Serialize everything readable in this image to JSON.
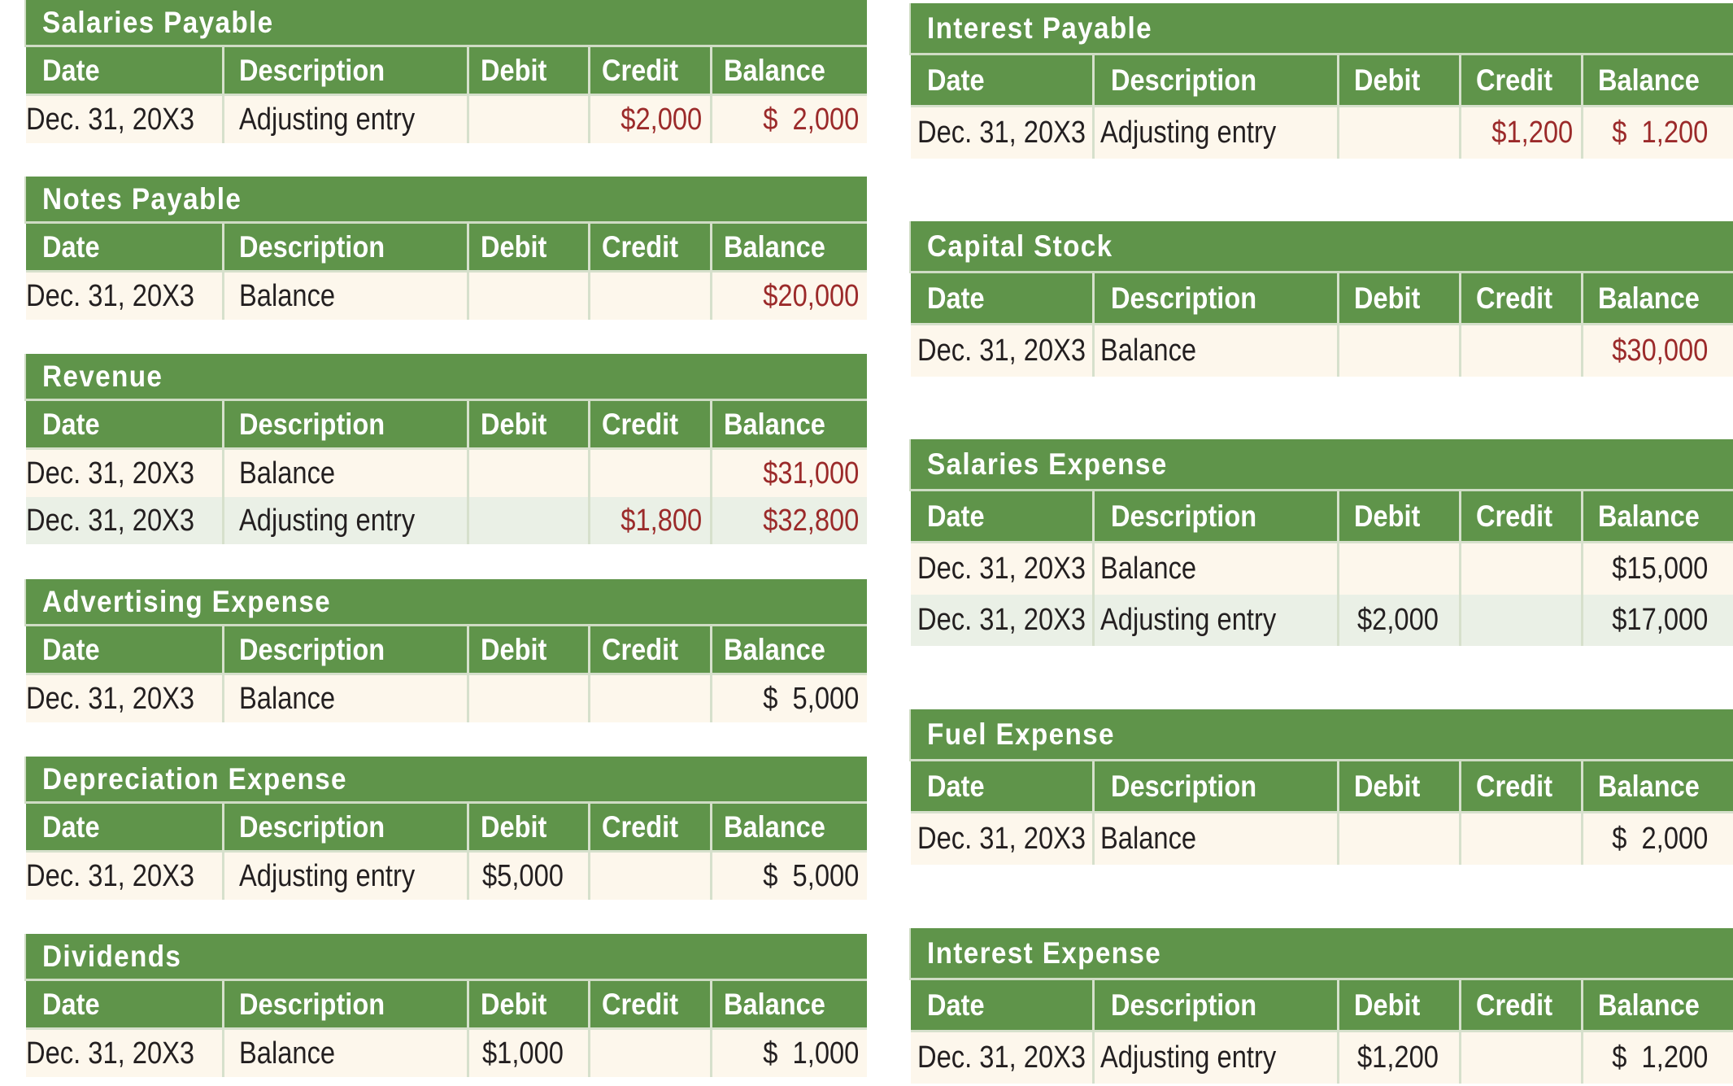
{
  "columns": [
    "Date",
    "Description",
    "Debit",
    "Credit",
    "Balance"
  ],
  "colors": {
    "header_green": "#5f944a",
    "row_cream": "#fdf7ec",
    "row_alt_green": "#eaf0e6",
    "credit_red": "#9b2a2a",
    "text_dark": "#231f20"
  },
  "left_accounts": [
    {
      "title": "Salaries Payable",
      "rows": [
        {
          "date": "Dec. 31, 20X3",
          "description": "Adjusting entry",
          "debit": "",
          "credit": "$2,000",
          "balance": "$  2,000",
          "red": true
        }
      ]
    },
    {
      "title": "Notes Payable",
      "rows": [
        {
          "date": "Dec. 31, 20X3",
          "description": "Balance",
          "debit": "",
          "credit": "",
          "balance": "$20,000",
          "red": true
        }
      ]
    },
    {
      "title": "Revenue",
      "rows": [
        {
          "date": "Dec. 31, 20X3",
          "description": "Balance",
          "debit": "",
          "credit": "",
          "balance": "$31,000",
          "red": true
        },
        {
          "date": "Dec. 31, 20X3",
          "description": "Adjusting entry",
          "debit": "",
          "credit": "$1,800",
          "balance": "$32,800",
          "red": true
        }
      ]
    },
    {
      "title": "Advertising Expense",
      "rows": [
        {
          "date": "Dec. 31, 20X3",
          "description": "Balance",
          "debit": "",
          "credit": "",
          "balance": "$  5,000",
          "red": false
        }
      ]
    },
    {
      "title": "Depreciation Expense",
      "rows": [
        {
          "date": "Dec. 31, 20X3",
          "description": "Adjusting entry",
          "debit": "$5,000",
          "credit": "",
          "balance": "$  5,000",
          "red": false
        }
      ]
    },
    {
      "title": "Dividends",
      "rows": [
        {
          "date": "Dec. 31, 20X3",
          "description": "Balance",
          "debit": "$1,000",
          "credit": "",
          "balance": "$  1,000",
          "red": false
        }
      ]
    }
  ],
  "right_accounts": [
    {
      "title": "Interest Payable",
      "rows": [
        {
          "date": "Dec. 31, 20X3",
          "description": "Adjusting entry",
          "debit": "",
          "credit": "$1,200",
          "balance": "$  1,200",
          "red": true
        }
      ]
    },
    {
      "title": "Capital Stock",
      "rows": [
        {
          "date": "Dec. 31, 20X3",
          "description": "Balance",
          "debit": "",
          "credit": "",
          "balance": "$30,000",
          "red": true
        }
      ]
    },
    {
      "title": "Salaries Expense",
      "rows": [
        {
          "date": "Dec. 31, 20X3",
          "description": "Balance",
          "debit": "",
          "credit": "",
          "balance": "$15,000",
          "red": false
        },
        {
          "date": "Dec. 31, 20X3",
          "description": "Adjusting entry",
          "debit": "$2,000",
          "credit": "",
          "balance": "$17,000",
          "red": false
        }
      ]
    },
    {
      "title": "Fuel Expense",
      "rows": [
        {
          "date": "Dec. 31, 20X3",
          "description": "Balance",
          "debit": "",
          "credit": "",
          "balance": "$  2,000",
          "red": false
        }
      ]
    },
    {
      "title": "Interest Expense",
      "rows": [
        {
          "date": "Dec. 31, 20X3",
          "description": "Adjusting entry",
          "debit": "$1,200",
          "credit": "",
          "balance": "$  1,200",
          "red": false
        }
      ]
    }
  ]
}
